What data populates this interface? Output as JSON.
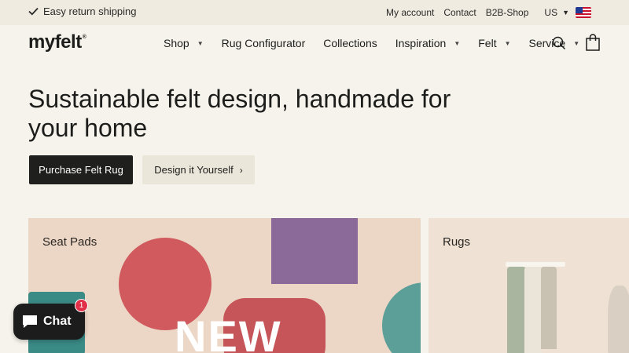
{
  "announcement": {
    "text": "Easy return shipping",
    "icon": "checkmark-icon"
  },
  "toplinks": {
    "account": "My account",
    "contact": "Contact",
    "b2b": "B2B-Shop",
    "country": "US",
    "flag_icon": "us-flag-icon"
  },
  "header": {
    "logo": "myfelt",
    "logo_mark": "®"
  },
  "nav": {
    "shop": "Shop",
    "configurator": "Rug Configurator",
    "collections": "Collections",
    "inspiration": "Inspiration",
    "felt": "Felt",
    "service": "Service",
    "search_icon": "search-icon",
    "cart_icon": "shopping-bag-icon"
  },
  "hero": {
    "title": "Sustainable felt design, handmade for your home",
    "primary_cta": "Purchase Felt Rug",
    "secondary_cta": "Design it Yourself",
    "secondary_chevron": "›"
  },
  "cards": {
    "seat_pads": {
      "label": "Seat Pads",
      "overlay": "NEW"
    },
    "rugs": {
      "label": "Rugs"
    }
  },
  "chat": {
    "label": "Chat",
    "badge": "1"
  },
  "colors": {
    "background": "#f6f3ec",
    "topbar": "#efebe1",
    "primary_button": "#1f1f1d",
    "secondary_button": "#eae6da",
    "badge": "#e02f47"
  }
}
